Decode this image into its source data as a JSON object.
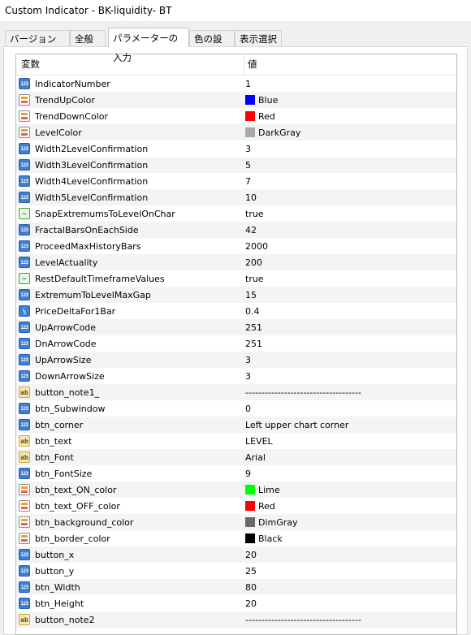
{
  "window": {
    "title": "Custom Indicator - BK-liquidity- BT"
  },
  "tabs": [
    {
      "label": "バージョン情報"
    },
    {
      "label": "全般"
    },
    {
      "label": "パラメーターの入力"
    },
    {
      "label": "色の設定"
    },
    {
      "label": "表示選択"
    }
  ],
  "table": {
    "header_name": "変数",
    "header_value": "値",
    "rows": [
      {
        "name": "IndicatorNumber",
        "value": "1",
        "icon": "int-icon"
      },
      {
        "name": "TrendUpColor",
        "value": "Blue",
        "icon": "color-icon",
        "swatch": "#0000ff"
      },
      {
        "name": "TrendDownColor",
        "value": "Red",
        "icon": "color-icon",
        "swatch": "#ff0000"
      },
      {
        "name": "LevelColor",
        "value": "DarkGray",
        "icon": "color-icon",
        "swatch": "#a9a9a9"
      },
      {
        "name": "Width2LevelConfirmation",
        "value": "3",
        "icon": "int-icon"
      },
      {
        "name": "Width3LevelConfirmation",
        "value": "5",
        "icon": "int-icon"
      },
      {
        "name": "Width4LevelConfirmation",
        "value": "7",
        "icon": "int-icon"
      },
      {
        "name": "Width5LevelConfirmation",
        "value": "10",
        "icon": "int-icon"
      },
      {
        "name": "SnapExtremumsToLevelOnChar",
        "value": "true",
        "icon": "bool-icon"
      },
      {
        "name": "FractalBarsOnEachSide",
        "value": "42",
        "icon": "int-icon"
      },
      {
        "name": "ProceedMaxHistoryBars",
        "value": "2000",
        "icon": "int-icon"
      },
      {
        "name": "LevelActuality",
        "value": "200",
        "icon": "int-icon"
      },
      {
        "name": "RestDefaultTimeframeValues",
        "value": "true",
        "icon": "bool-icon"
      },
      {
        "name": "ExtremumToLevelMaxGap",
        "value": "15",
        "icon": "int-icon"
      },
      {
        "name": "PriceDeltaFor1Bar",
        "value": "0.4",
        "icon": "double-icon"
      },
      {
        "name": "UpArrowCode",
        "value": "251",
        "icon": "int-icon"
      },
      {
        "name": "DnArrowCode",
        "value": "251",
        "icon": "int-icon"
      },
      {
        "name": "UpArrowSize",
        "value": "3",
        "icon": "int-icon"
      },
      {
        "name": "DownArrowSize",
        "value": "3",
        "icon": "int-icon"
      },
      {
        "name": "button_note1_",
        "value": "------------------------------------",
        "icon": "string-icon"
      },
      {
        "name": "btn_Subwindow",
        "value": "0",
        "icon": "int-icon"
      },
      {
        "name": "btn_corner",
        "value": "Left upper chart corner",
        "icon": "int-icon"
      },
      {
        "name": "btn_text",
        "value": "LEVEL",
        "icon": "string-icon"
      },
      {
        "name": "btn_Font",
        "value": "Arial",
        "icon": "string-icon"
      },
      {
        "name": "btn_FontSize",
        "value": "9",
        "icon": "int-icon"
      },
      {
        "name": "btn_text_ON_color",
        "value": "Lime",
        "icon": "color-icon",
        "swatch": "#00ff00"
      },
      {
        "name": "btn_text_OFF_color",
        "value": "Red",
        "icon": "color-icon",
        "swatch": "#ff0000"
      },
      {
        "name": "btn_background_color",
        "value": "DimGray",
        "icon": "color-icon",
        "swatch": "#696969"
      },
      {
        "name": "btn_border_color",
        "value": "Black",
        "icon": "color-icon",
        "swatch": "#000000"
      },
      {
        "name": "button_x",
        "value": "20",
        "icon": "int-icon"
      },
      {
        "name": "button_y",
        "value": "25",
        "icon": "int-icon"
      },
      {
        "name": "btn_Width",
        "value": "80",
        "icon": "int-icon"
      },
      {
        "name": "btn_Height",
        "value": "20",
        "icon": "int-icon"
      },
      {
        "name": "button_note2",
        "value": "------------------------------------",
        "icon": "string-icon"
      }
    ]
  }
}
